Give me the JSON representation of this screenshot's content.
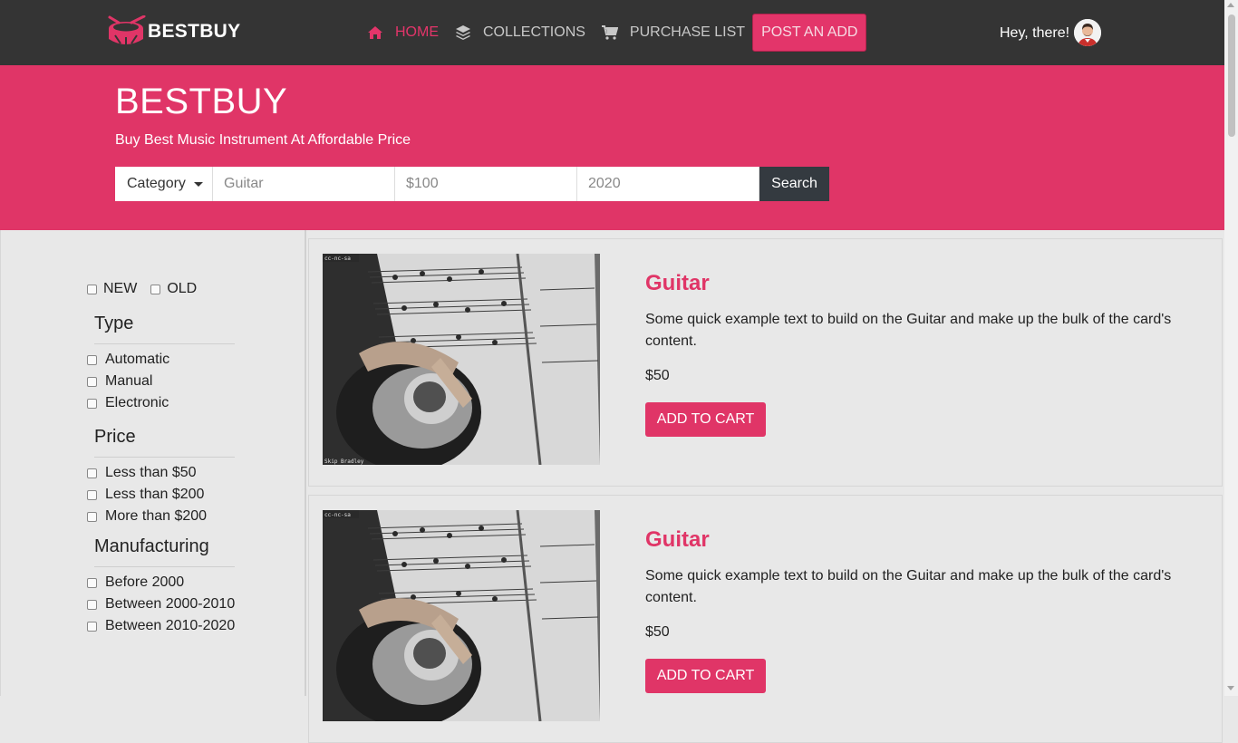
{
  "nav": {
    "brand": "BESTBUY",
    "items": [
      {
        "label": "HOME",
        "icon": "home-icon"
      },
      {
        "label": "COLLECTIONS",
        "icon": "layers-icon"
      },
      {
        "label": "PURCHASE LIST",
        "icon": "cart-icon"
      }
    ],
    "post_label": "POST AN ADD",
    "greeting": "Hey, there!"
  },
  "hero": {
    "title": "BESTBUY",
    "subtitle": "Buy Best Music Instrument At Affordable Price",
    "category_label": "Category",
    "instrument_placeholder": "Guitar",
    "price_placeholder": "$100",
    "year_placeholder": "2020",
    "search_label": "Search"
  },
  "filters": {
    "condition": [
      "NEW",
      "OLD"
    ],
    "type_title": "Type",
    "type_options": [
      "Automatic",
      "Manual",
      "Electronic"
    ],
    "price_title": "Price",
    "price_options": [
      "Less than $50",
      "Less than $200",
      "More than $200"
    ],
    "mfg_title": "Manufacturing",
    "mfg_options": [
      "Before 2000",
      "Between 2000-2010",
      "Between 2010-2020"
    ]
  },
  "products": [
    {
      "title": "Guitar",
      "text": "Some quick example text to build on the Guitar and make up the bulk of the card's content.",
      "price": "$50",
      "button": "ADD TO CART",
      "img_license": "cc-nc-sa",
      "img_credit": "Skip Bradley"
    },
    {
      "title": "Guitar",
      "text": "Some quick example text to build on the Guitar and make up the bulk of the card's content.",
      "price": "$50",
      "button": "ADD TO CART",
      "img_license": "cc-nc-sa",
      "img_credit": ""
    }
  ],
  "colors": {
    "accent": "#e03567",
    "navbar": "#343434",
    "search_btn": "#343a40"
  }
}
